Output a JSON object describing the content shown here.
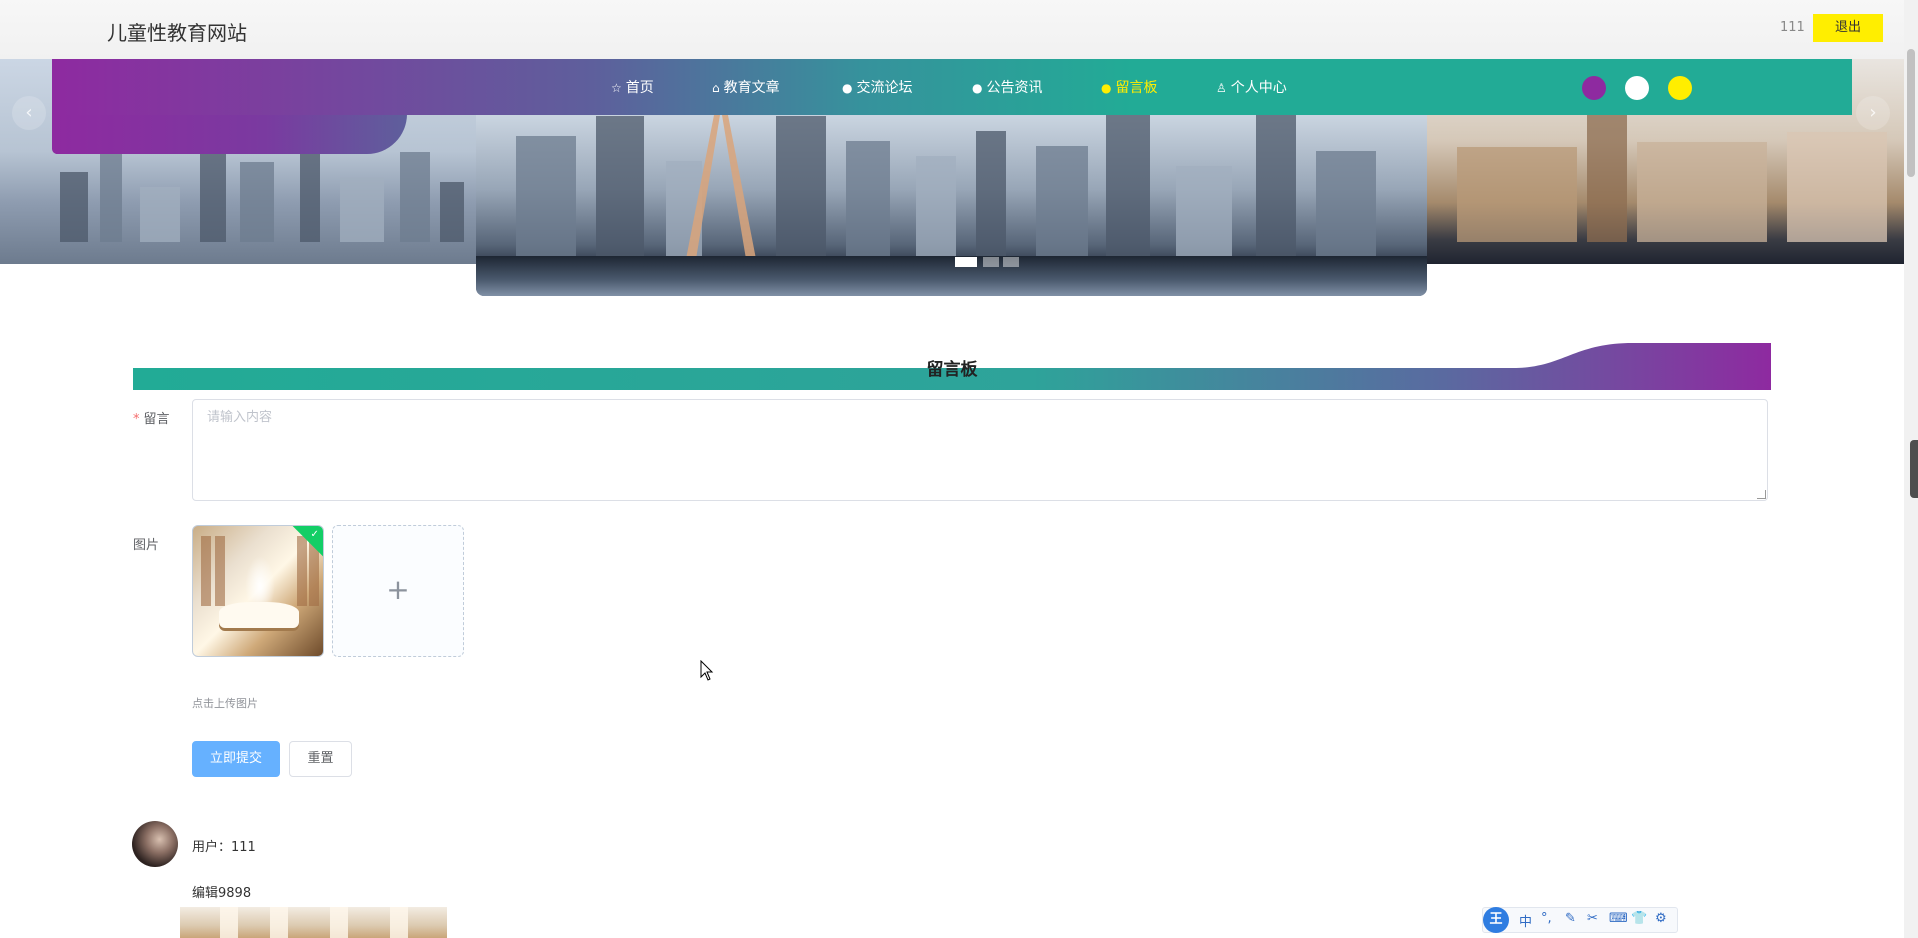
{
  "header": {
    "site_title": "儿童性教育网站",
    "user_name": "111",
    "logout_label": "退出"
  },
  "colors": {
    "nav_gradient_start": "#8e2aa0",
    "nav_gradient_end": "#22ab96",
    "active_nav": "#ffee00",
    "logout_button": "#ffee00",
    "primary_button": "#66b1ff"
  },
  "nav": {
    "items": [
      {
        "label": "首页",
        "icon": "star-icon"
      },
      {
        "label": "教育文章",
        "icon": "bag-icon"
      },
      {
        "label": "交流论坛",
        "icon": "info-icon"
      },
      {
        "label": "公告资讯",
        "icon": "info-icon"
      },
      {
        "label": "留言板",
        "icon": "info-icon",
        "active": true
      },
      {
        "label": "个人中心",
        "icon": "user-icon"
      }
    ],
    "theme_swatches": [
      "#8e2aa0",
      "#ffffff",
      "#ffee00"
    ]
  },
  "carousel": {
    "prev_label": "‹",
    "next_label": "›",
    "slide_count": 3,
    "active_slide": 1
  },
  "page": {
    "section_title": "留言板",
    "form": {
      "message_label": "留言",
      "message_placeholder": "请输入内容",
      "image_label": "图片",
      "upload_plus": "+",
      "upload_tip": "点击上传图片",
      "submit_label": "立即提交",
      "reset_label": "重置"
    }
  },
  "comments": [
    {
      "user_label": "用户：111",
      "content": "编辑9898"
    }
  ],
  "ime_toolbar": {
    "logo": "王",
    "items": [
      "中",
      "°,",
      "✎",
      "✂",
      "⌨",
      "👕",
      "⚙"
    ]
  }
}
